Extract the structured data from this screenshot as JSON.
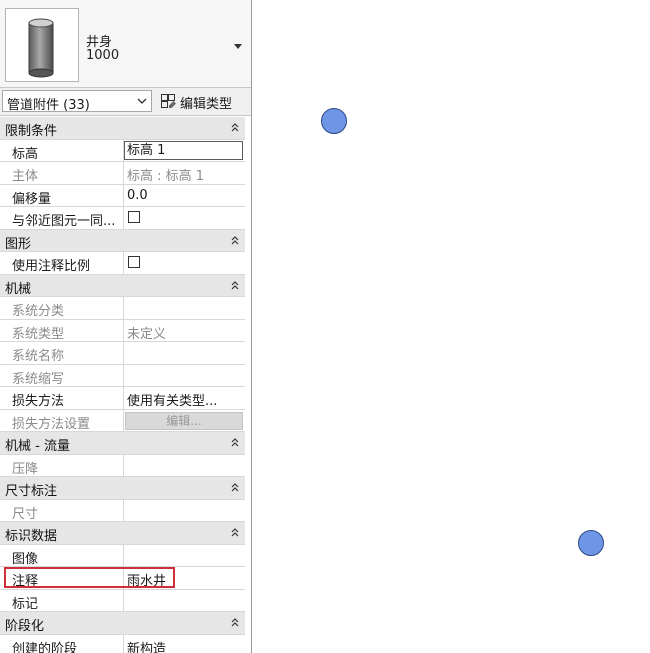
{
  "type_selector": {
    "name": "井身",
    "size": "1000"
  },
  "filter": {
    "label": "管道附件 (33)",
    "edit_type_label": "编辑类型"
  },
  "groups": {
    "constraints": {
      "label": "限制条件",
      "level": {
        "name": "标高",
        "value": "标高 1"
      },
      "host": {
        "name": "主体",
        "value": "标高 : 标高 1"
      },
      "offset": {
        "name": "偏移量",
        "value": "0.0"
      },
      "move_with_nearby": {
        "name": "与邻近图元一同..."
      }
    },
    "graphics": {
      "label": "图形",
      "use_annotation_scale": {
        "name": "使用注释比例"
      }
    },
    "mechanical": {
      "label": "机械",
      "system_classification": {
        "name": "系统分类",
        "value": ""
      },
      "system_type": {
        "name": "系统类型",
        "value": "未定义"
      },
      "system_name": {
        "name": "系统名称",
        "value": ""
      },
      "system_abbreviation": {
        "name": "系统缩写",
        "value": ""
      },
      "loss_method": {
        "name": "损失方法",
        "value": "使用有关类型..."
      },
      "loss_method_settings": {
        "name": "损失方法设置",
        "button_label": "编辑..."
      }
    },
    "mechanical_flow": {
      "label": "机械 - 流量",
      "pressure_drop": {
        "name": "压降",
        "value": ""
      }
    },
    "dimensions": {
      "label": "尺寸标注",
      "size": {
        "name": "尺寸",
        "value": ""
      }
    },
    "identity_data": {
      "label": "标识数据",
      "image": {
        "name": "图像",
        "value": ""
      },
      "comments": {
        "name": "注释",
        "value": "雨水井"
      },
      "mark": {
        "name": "标记",
        "value": ""
      }
    },
    "phasing": {
      "label": "阶段化",
      "phase_created": {
        "name": "创建的阶段",
        "value": "新构造"
      }
    }
  },
  "colors": {
    "highlight": "#d02f3a",
    "node_fill": "#6f95e6"
  }
}
